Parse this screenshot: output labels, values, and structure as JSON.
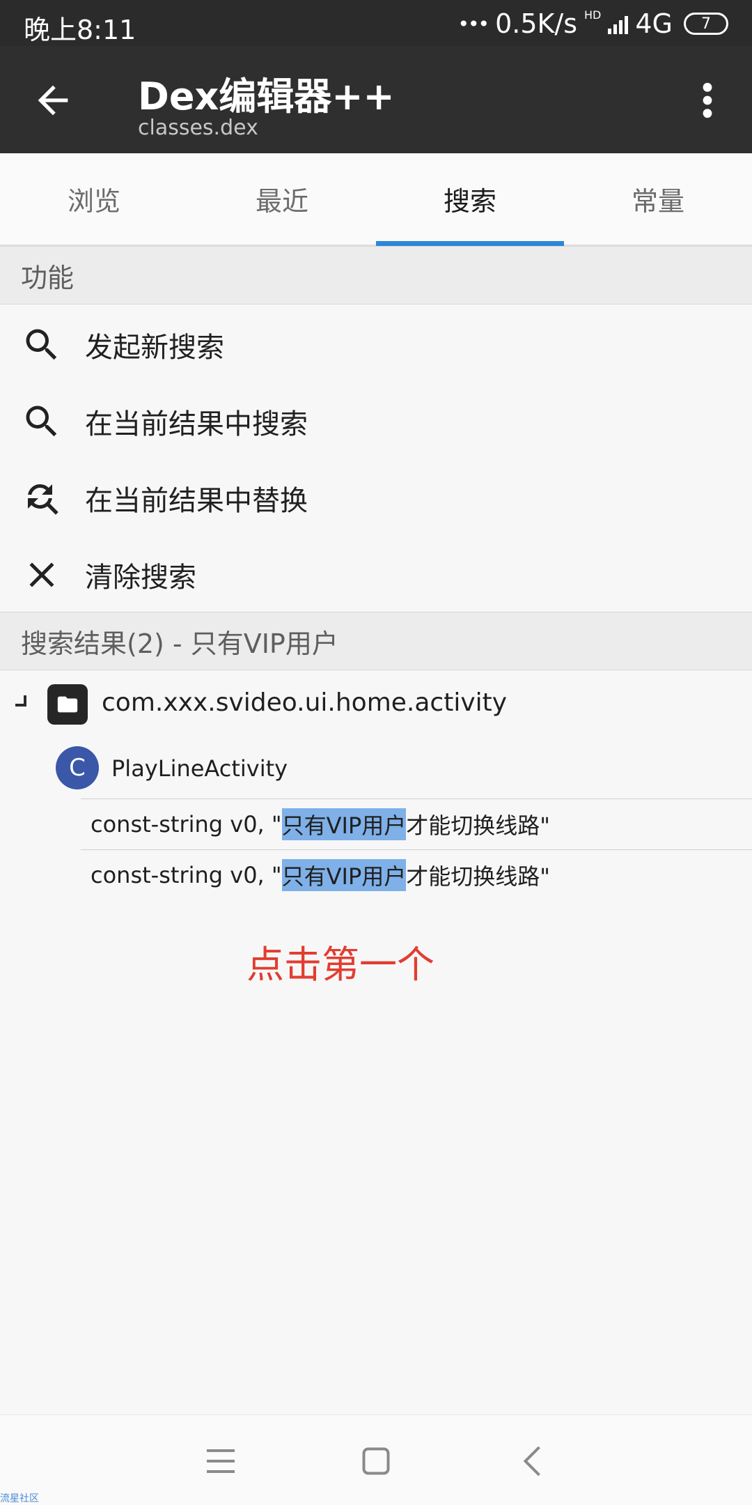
{
  "status_bar": {
    "time": "晚上8:11",
    "net_speed": "0.5K/s",
    "hd_label": "HD",
    "network": "4G",
    "battery": "7"
  },
  "toolbar": {
    "title": "Dex编辑器++",
    "subtitle": "classes.dex"
  },
  "tabs": [
    {
      "label": "浏览",
      "active": false
    },
    {
      "label": "最近",
      "active": false
    },
    {
      "label": "搜索",
      "active": true
    },
    {
      "label": "常量",
      "active": false
    }
  ],
  "functions_section": {
    "header": "功能",
    "items": [
      {
        "label": "发起新搜索",
        "icon": "search-icon"
      },
      {
        "label": "在当前结果中搜索",
        "icon": "search-icon"
      },
      {
        "label": "在当前结果中替换",
        "icon": "find-replace-icon"
      },
      {
        "label": "清除搜索",
        "icon": "close-icon"
      }
    ]
  },
  "results_section": {
    "header": "搜索结果(2) - 只有VIP用户",
    "package": "com.xxx.svideo.ui.home.activity",
    "class_badge": "C",
    "class_name": "PlayLineActivity",
    "results": [
      {
        "prefix": "const-string v0, \"",
        "highlight": "只有VIP用户",
        "suffix": "才能切换线路\""
      },
      {
        "prefix": "const-string v0, \"",
        "highlight": "只有VIP用户",
        "suffix": "才能切换线路\""
      }
    ]
  },
  "annotation": "点击第一个",
  "watermark": "流星社区",
  "colors": {
    "accent": "#2f86d8",
    "highlight": "#7fb0e8",
    "annotation": "#e23d31",
    "toolbar": "#2f2f2f"
  }
}
